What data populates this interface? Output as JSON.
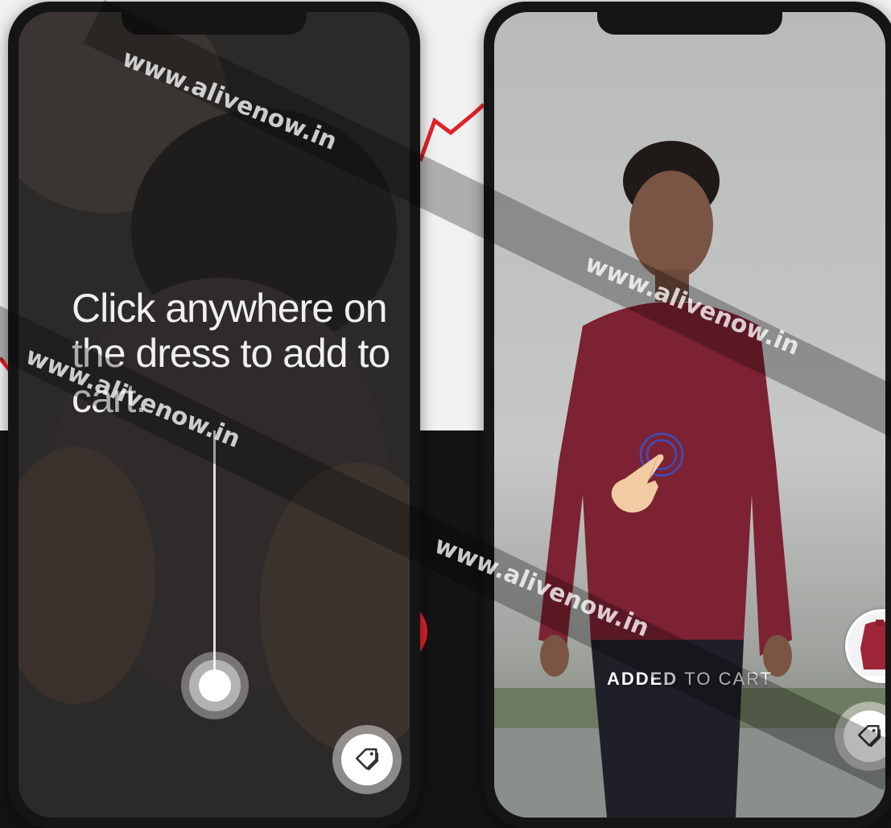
{
  "left_screen": {
    "instruction": "Click anywhere on the dress to add to cart."
  },
  "right_screen": {
    "status_label_bold": "ADDED",
    "status_label_rest": "TO CART"
  },
  "watermarks": [
    "www.alivenow.in",
    "www.alivenow.in",
    "www.alivenow.in",
    "www.alivenow.in"
  ],
  "icons": {
    "tag": "tag-icon",
    "tap": "tap-hand-icon",
    "drag": "drag-handle-icon"
  },
  "colors": {
    "accent_red": "#e2202a",
    "product_maroon": "#7d2233",
    "overlay_dark": "#141414"
  }
}
